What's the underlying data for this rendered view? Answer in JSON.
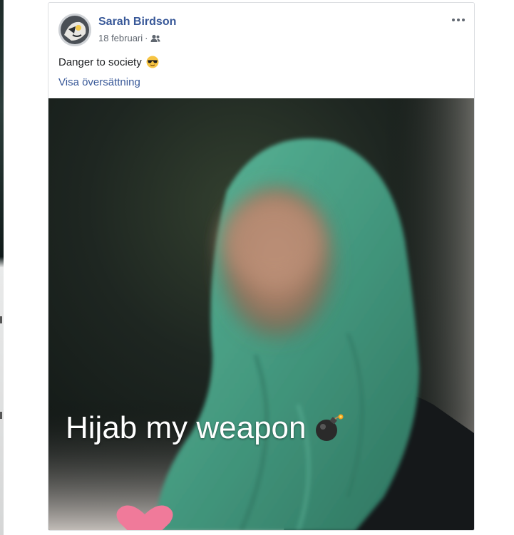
{
  "post": {
    "author": "Sarah Birdson",
    "date": "18 februari",
    "audience_icon": "friends-icon",
    "text": "Danger to society",
    "emoji_icon": "sunglasses-emoji-icon",
    "translate_link": "Visa översättning",
    "more_icon": "more-options-icon"
  },
  "photo": {
    "overlay_text": "Hijab my weapon",
    "overlay_emoji_icon": "bomb-emoji-icon",
    "reaction_icon": "heart-icon",
    "subject": "blurred face, green patterned hijab"
  },
  "colors": {
    "author": "#385898",
    "link": "#385898",
    "hijab": "#4fa88c",
    "heart": "#f07a9a"
  }
}
